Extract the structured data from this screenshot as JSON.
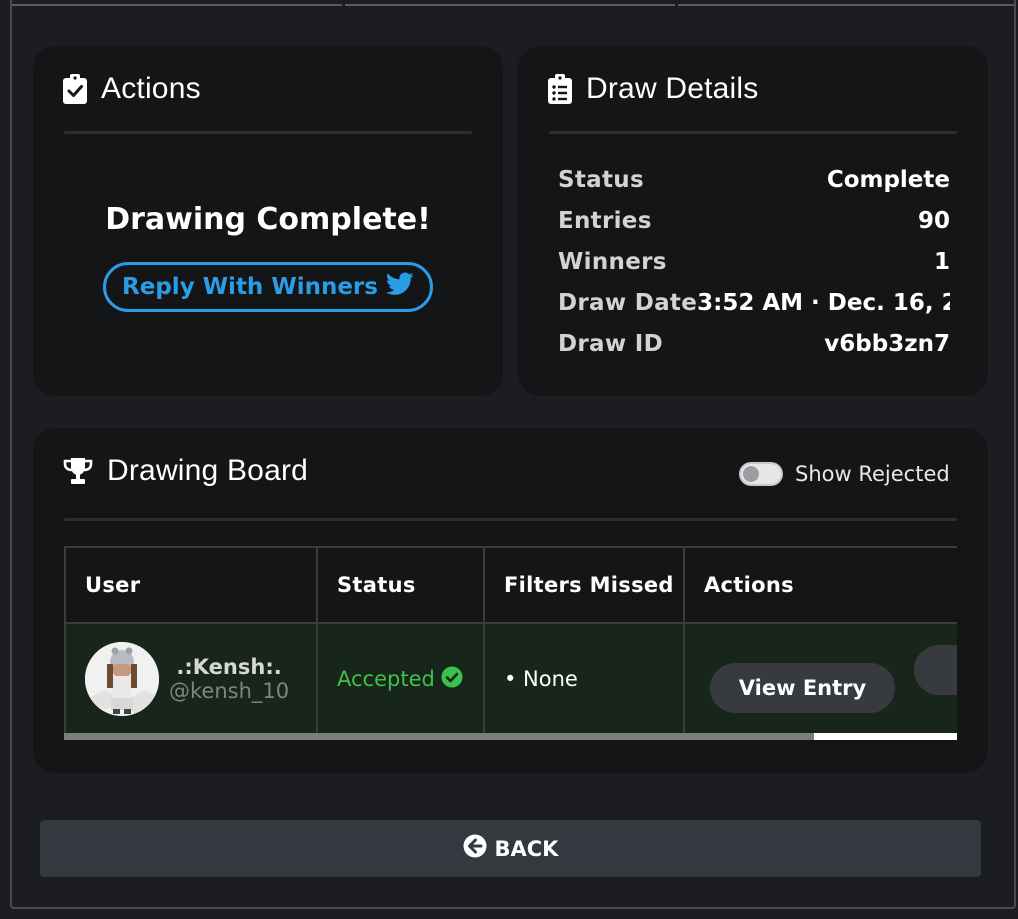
{
  "actions": {
    "title": "Actions",
    "message": "Drawing Complete!",
    "reply_label": "Reply With Winners"
  },
  "details": {
    "title": "Draw Details",
    "rows": [
      {
        "key": "Status",
        "value": "Complete"
      },
      {
        "key": "Entries",
        "value": "90"
      },
      {
        "key": "Winners",
        "value": "1"
      },
      {
        "key": "Draw Date",
        "value": "3:52 AM · Dec. 16, 2"
      },
      {
        "key": "Draw ID",
        "value": "v6bb3zn7"
      }
    ]
  },
  "board": {
    "title": "Drawing Board",
    "toggle_label": "Show Rejected",
    "toggle_on": false,
    "columns": [
      "User",
      "Status",
      "Filters Missed",
      "Actions"
    ],
    "rows": [
      {
        "name": ".:Kensh:.",
        "handle": "@kensh_10",
        "status": "Accepted",
        "filters": "• None",
        "action": "View Entry"
      }
    ],
    "horizontal_scroll_fraction": 0.84
  },
  "footer": {
    "back_label": "BACK"
  },
  "colors": {
    "accent_blue": "#2a9de6",
    "accepted_green": "#3cc14a",
    "card_bg": "#141517",
    "page_bg": "#1b1d20"
  },
  "icons": {
    "actions": "clipboard-check-icon",
    "details": "clipboard-list-icon",
    "board": "trophy-icon",
    "reply": "twitter-bird-icon",
    "accepted": "check-circle-icon",
    "back": "arrow-circle-left-icon"
  }
}
